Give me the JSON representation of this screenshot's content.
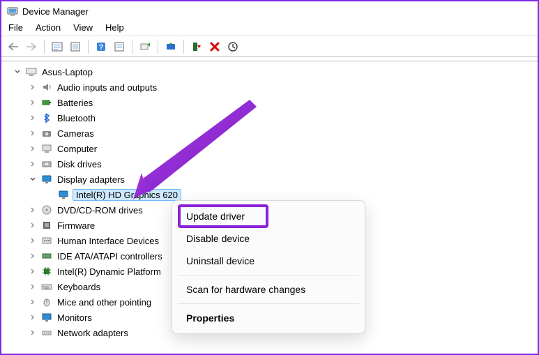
{
  "app": {
    "title": "Device Manager"
  },
  "menu": {
    "file": "File",
    "action": "Action",
    "view": "View",
    "help": "Help"
  },
  "toolbar_icons": {
    "back": "back-icon",
    "forward": "forward-icon",
    "manage": "manage-icon",
    "properties": "properties-icon",
    "help": "help-icon",
    "enable": "enable-icon",
    "update": "update-icon",
    "update_driver": "update-driver-icon",
    "uninstall": "uninstall-icon",
    "delete": "delete-icon",
    "scan": "scan-icon"
  },
  "tree": {
    "root": "Asus-Laptop",
    "items": [
      {
        "label": "Audio inputs and outputs",
        "icon": "speaker-icon"
      },
      {
        "label": "Batteries",
        "icon": "battery-icon"
      },
      {
        "label": "Bluetooth",
        "icon": "bluetooth-icon"
      },
      {
        "label": "Cameras",
        "icon": "camera-icon"
      },
      {
        "label": "Computer",
        "icon": "computer-icon"
      },
      {
        "label": "Disk drives",
        "icon": "disk-icon"
      },
      {
        "label": "Display adapters",
        "icon": "display-icon",
        "expanded": true,
        "children": [
          {
            "label": "Intel(R) HD Graphics 620",
            "icon": "display-icon",
            "selected": true
          }
        ]
      },
      {
        "label": "DVD/CD-ROM drives",
        "icon": "dvd-icon"
      },
      {
        "label": "Firmware",
        "icon": "firmware-icon"
      },
      {
        "label": "Human Interface Devices",
        "icon": "hid-icon"
      },
      {
        "label": "IDE ATA/ATAPI controllers",
        "icon": "ide-icon"
      },
      {
        "label": "Intel(R) Dynamic Platform",
        "icon": "chip-icon"
      },
      {
        "label": "Keyboards",
        "icon": "keyboard-icon"
      },
      {
        "label": "Mice and other pointing",
        "icon": "mouse-icon"
      },
      {
        "label": "Monitors",
        "icon": "monitor-icon"
      },
      {
        "label": "Network adapters",
        "icon": "network-icon"
      }
    ]
  },
  "context_menu": {
    "update": "Update driver",
    "disable": "Disable device",
    "uninstall": "Uninstall device",
    "scan": "Scan for hardware changes",
    "properties": "Properties"
  }
}
